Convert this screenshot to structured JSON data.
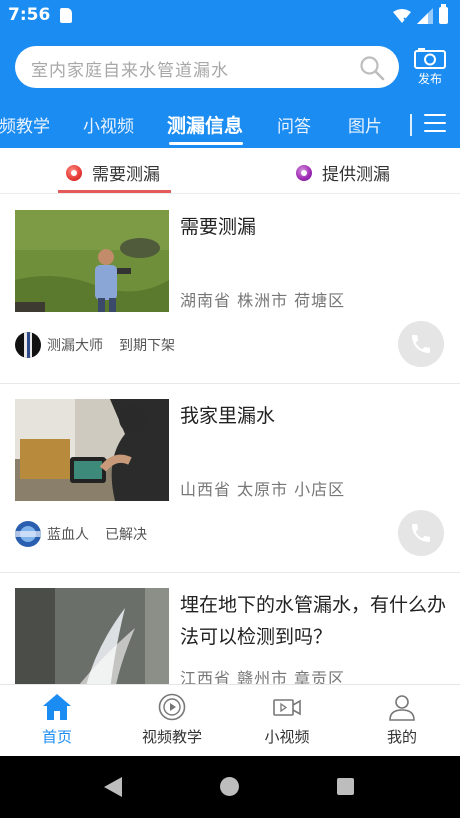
{
  "status_bar": {
    "time": "7:56",
    "icons": [
      "sd-card-icon",
      "wifi-icon",
      "signal-icon",
      "battery-icon"
    ]
  },
  "search": {
    "placeholder": "室内家庭自来水管道漏水",
    "icon": "search-icon"
  },
  "publish": {
    "label": "发布",
    "icon": "camera-icon"
  },
  "channels": {
    "tabs": [
      {
        "label": "视频教学",
        "active": false
      },
      {
        "label": "小视频",
        "active": false
      },
      {
        "label": "测漏信息",
        "active": true
      },
      {
        "label": "问答",
        "active": false
      },
      {
        "label": "图片",
        "active": false
      }
    ],
    "menu_icon": "menu-icon"
  },
  "subtabs": [
    {
      "label": "需要测漏",
      "active": true,
      "icon_color": "#e53935"
    },
    {
      "label": "提供测漏",
      "active": false,
      "icon_color": "#9c27b0"
    }
  ],
  "feed": [
    {
      "title": "需要测漏",
      "location": "湖南省 株洲市 荷塘区",
      "user": "测漏大师",
      "status": "到期下架",
      "thumbnail": "man-in-field-photo",
      "avatar": "dark-avatar"
    },
    {
      "title": "我家里漏水",
      "location": "山西省 太原市 小店区",
      "user": "蓝血人",
      "status": "已解决",
      "thumbnail": "leak-detector-photo",
      "avatar": "blue-avatar"
    },
    {
      "title": "埋在地下的水管漏水，有什么办法可以检测到吗？",
      "location": "江西省 赣州市 章贡区",
      "user": "",
      "status": "",
      "thumbnail": "water-spray-photo",
      "avatar": ""
    }
  ],
  "bottom_nav": [
    {
      "label": "首页",
      "icon": "home-icon",
      "active": true
    },
    {
      "label": "视频教学",
      "icon": "video-play-icon",
      "active": false
    },
    {
      "label": "小视频",
      "icon": "camcorder-icon",
      "active": false
    },
    {
      "label": "我的",
      "icon": "user-icon",
      "active": false
    }
  ],
  "colors": {
    "brand_blue": "#1b8cf2",
    "subtab_underline": "#e45a5a",
    "muted_text": "#777777"
  }
}
